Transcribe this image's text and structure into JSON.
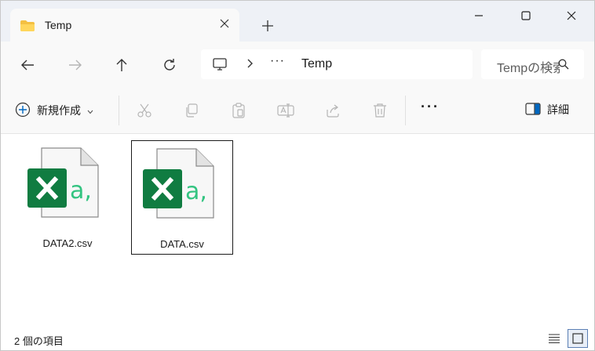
{
  "tab": {
    "title": "Temp",
    "icon": "folder-icon"
  },
  "window_controls": [
    "minimize-icon",
    "maximize-icon",
    "close-icon"
  ],
  "nav": {
    "back_icon": "arrow-left-icon",
    "forward_icon": "arrow-right-icon",
    "up_icon": "arrow-up-icon",
    "refresh_icon": "refresh-icon"
  },
  "address": {
    "root_icon": "this-pc-icon",
    "overflow": "···",
    "current": "Temp"
  },
  "search": {
    "placeholder": "Tempの検索"
  },
  "commands": {
    "new_label": "新規作成",
    "icons": [
      "cut-icon",
      "copy-icon",
      "paste-icon",
      "rename-icon",
      "share-icon",
      "delete-icon"
    ],
    "more": "···",
    "details_label": "詳細"
  },
  "files": [
    {
      "name": "DATA2.csv",
      "icon": "excel-csv-icon",
      "selected": false
    },
    {
      "name": "DATA.csv",
      "icon": "excel-csv-icon",
      "selected": true
    }
  ],
  "status": {
    "item_count": "2 個の項目"
  },
  "view_modes": [
    "details-view-icon",
    "large-icons-view-icon"
  ],
  "colors": {
    "excel_green": "#107c41",
    "excel_light_green": "#33c481",
    "accent": "#0067c0"
  }
}
